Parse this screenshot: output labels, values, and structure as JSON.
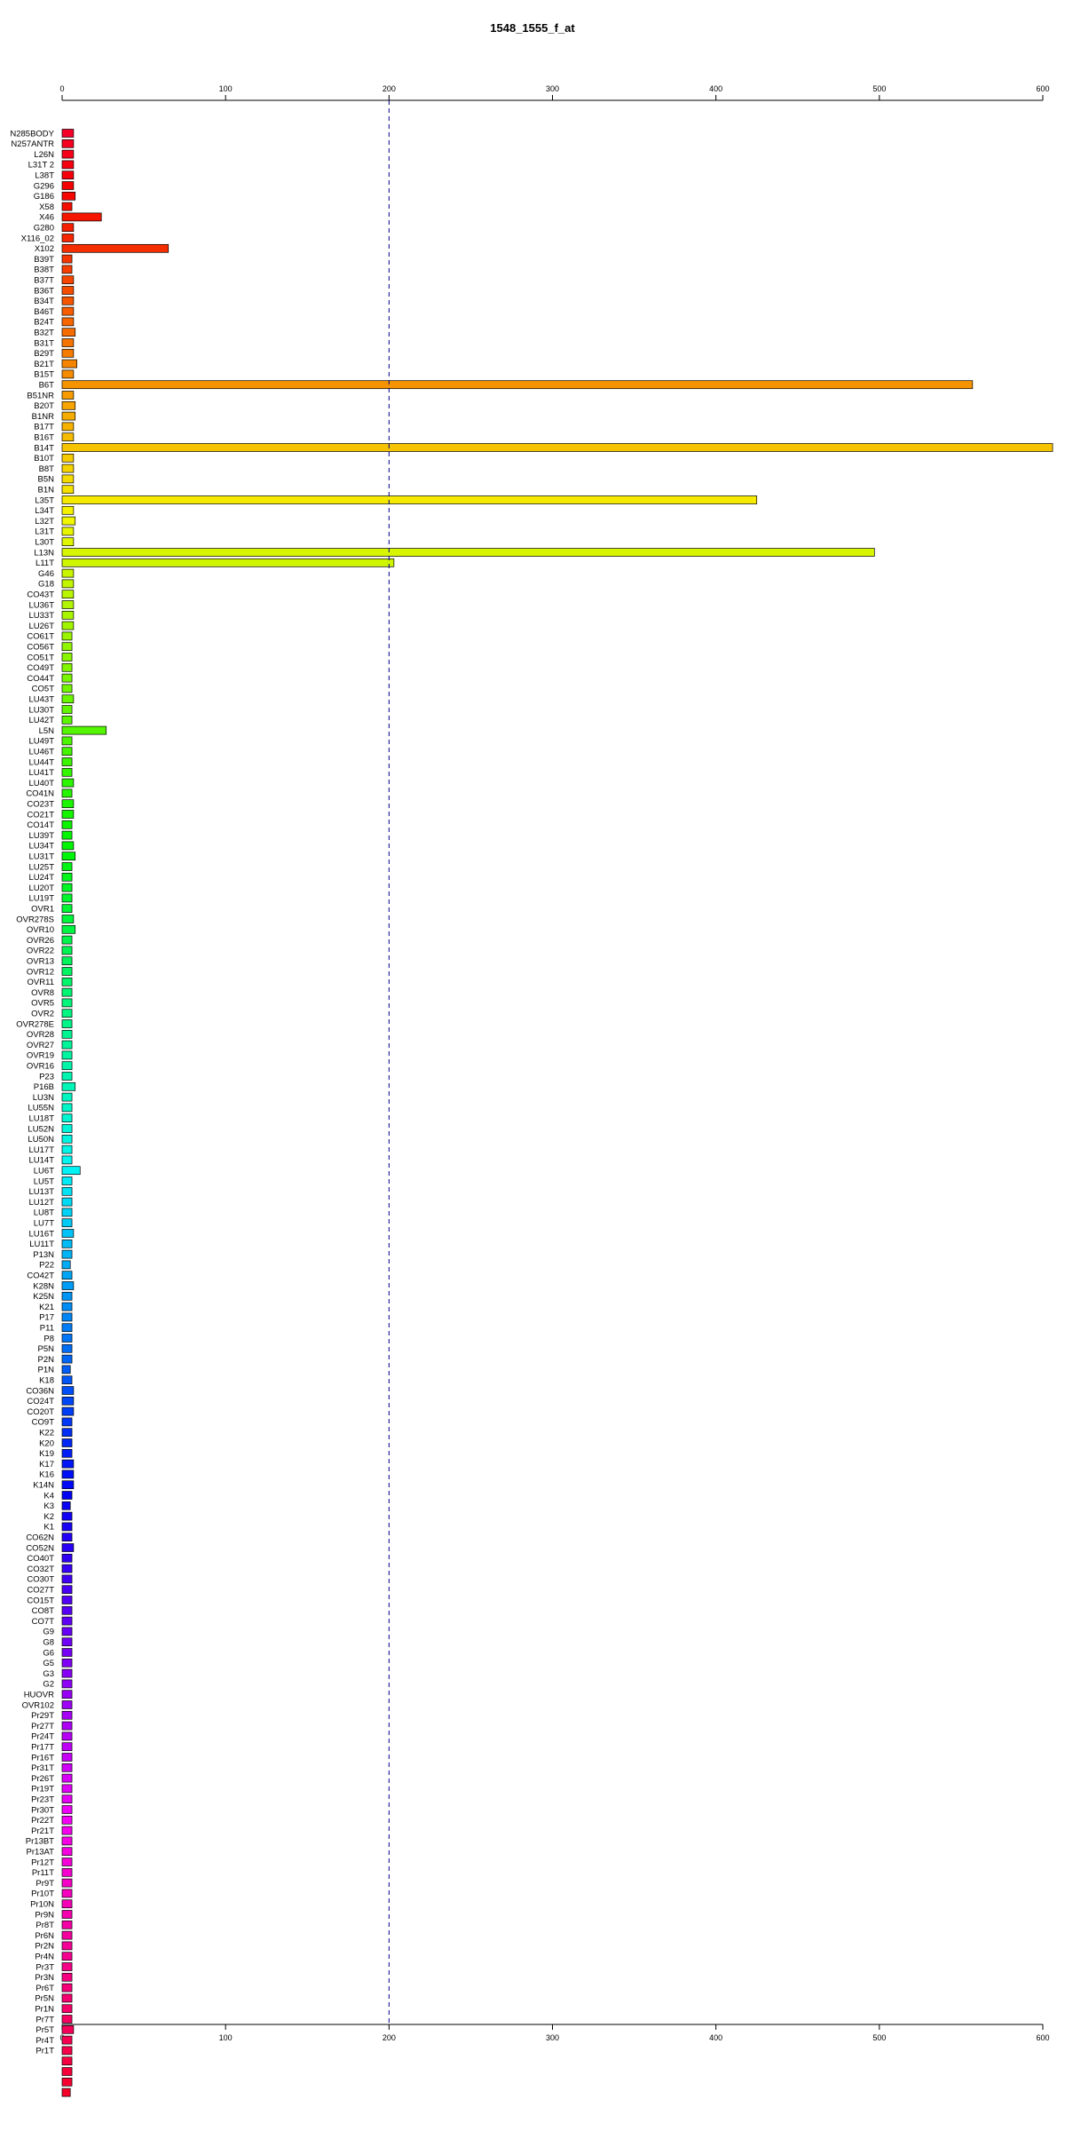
{
  "chart_data": {
    "type": "bar",
    "orientation": "horizontal",
    "title": "1548_1555_f_at",
    "xlim": [
      0,
      600
    ],
    "xticks": [
      0,
      100,
      200,
      300,
      400,
      500,
      600
    ],
    "reference_line": 200,
    "reference_line_color": "#00008b",
    "grid": false,
    "legend": "none",
    "categories": [
      "N285BODY",
      "N257ANTR",
      "L26N",
      "L31T 2",
      "L38T",
      "G296",
      "G186",
      "X58",
      "X46",
      "G280",
      "X116_02",
      "X102",
      "B39T",
      "B38T",
      "B37T",
      "B36T",
      "B34T",
      "B46T",
      "B24T",
      "B32T",
      "B31T",
      "B29T",
      "B21T",
      "B15T",
      "B6T",
      "B51NR",
      "B20T",
      "B1NR",
      "B17T",
      "B16T",
      "B14T",
      "B10T",
      "B8T",
      "B5N",
      "B1N",
      "L35T",
      "L34T",
      "L32T",
      "L31T",
      "L30T",
      "L13N",
      "L11T",
      "G46",
      "G18",
      "CO43T",
      "LU36T",
      "LU33T",
      "LU26T",
      "CO61T",
      "CO56T",
      "CO51T",
      "CO49T",
      "CO44T",
      "CO5T",
      "LU43T",
      "LU30T",
      "LU42T",
      "L5N",
      "LU49T",
      "LU46T",
      "LU44T",
      "LU41T",
      "LU40T",
      "CO41N",
      "CO23T",
      "CO21T",
      "CO14T",
      "LU39T",
      "LU34T",
      "LU31T",
      "LU25T",
      "LU24T",
      "LU20T",
      "LU19T",
      "OVR1",
      "OVR278S",
      "OVR10",
      "OVR26",
      "OVR22",
      "OVR13",
      "OVR12",
      "OVR11",
      "OVR8",
      "OVR5",
      "OVR2",
      "OVR278E",
      "OVR28",
      "OVR27",
      "OVR19",
      "OVR16",
      "P23",
      "P16B",
      "LU3N",
      "LU55N",
      "LU18T",
      "LU52N",
      "LU50N",
      "LU17T",
      "LU14T",
      "LU6T",
      "LU5T",
      "LU13T",
      "LU12T",
      "LU8T",
      "LU7T",
      "LU16T",
      "LU11T",
      "P13N",
      "P22",
      "CO42T",
      "K28N",
      "K25N",
      "K21",
      "P17",
      "P11",
      "P8",
      "P5N",
      "P2N",
      "P1N",
      "K18",
      "CO36N",
      "CO24T",
      "CO20T",
      "CO9T",
      "K22",
      "K20",
      "K19",
      "K17",
      "K16",
      "K14N",
      "K4",
      "K3",
      "K2",
      "K1",
      "CO62N",
      "CO52N",
      "CO40T",
      "CO32T",
      "CO30T",
      "CO27T",
      "CO15T",
      "CO8T",
      "CO7T",
      "G9",
      "G8",
      "G6",
      "G5",
      "G3",
      "G2",
      "HUOVR",
      "OVR102",
      "Pr29T",
      "Pr27T",
      "Pr24T",
      "Pr17T",
      "Pr16T",
      "Pr31T",
      "Pr26T",
      "Pr19T",
      "Pr23T",
      "Pr30T",
      "Pr22T",
      "Pr21T",
      "Pr13BT",
      "Pr13AT",
      "Pr12T",
      "Pr11T",
      "Pr9T",
      "Pr10T",
      "Pr10N",
      "Pr9N",
      "Pr8T",
      "Pr6N",
      "Pr2N",
      "Pr4N",
      "Pr3T",
      "Pr3N",
      "Pr6T",
      "Pr5N",
      "Pr1N",
      "Pr7T",
      "Pr5T",
      "Pr4T",
      "Pr1T"
    ],
    "values": [
      7,
      7,
      7,
      7,
      7,
      7,
      8,
      6,
      24,
      7,
      7,
      65,
      6,
      6,
      7,
      7,
      7,
      7,
      7,
      8,
      7,
      7,
      9,
      7,
      557,
      7,
      8,
      8,
      7,
      7,
      606,
      7,
      7,
      7,
      7,
      425,
      7,
      8,
      7,
      7,
      497,
      203,
      7,
      7,
      7,
      7,
      7,
      7,
      6,
      6,
      6,
      6,
      6,
      6,
      7,
      6,
      6,
      27,
      6,
      6,
      6,
      6,
      7,
      6,
      7,
      7,
      6,
      6,
      7,
      8,
      6,
      6,
      6,
      6,
      6,
      7,
      8,
      6,
      6,
      6,
      6,
      6,
      6,
      6,
      6,
      6,
      6,
      6,
      6,
      6,
      6,
      8,
      6,
      6,
      6,
      6,
      6,
      6,
      6,
      11,
      6,
      6,
      6,
      6,
      6,
      7,
      6,
      6,
      5,
      6,
      7,
      6,
      6,
      6,
      6,
      6,
      6,
      6,
      5,
      6,
      7,
      7,
      7,
      6,
      6,
      6,
      6,
      7,
      7,
      7,
      6,
      5,
      6,
      6,
      6,
      7,
      6,
      6,
      6,
      6,
      6,
      6,
      6,
      6,
      6,
      6,
      6,
      6,
      6,
      6,
      6,
      6,
      6,
      6,
      6,
      6,
      6,
      6,
      6,
      6,
      6,
      6,
      6,
      6,
      6,
      6,
      6,
      6,
      6,
      6,
      6,
      6,
      6,
      6,
      6,
      6,
      6,
      6,
      6,
      6,
      6,
      7,
      6,
      6,
      6,
      6,
      6,
      5
    ]
  }
}
